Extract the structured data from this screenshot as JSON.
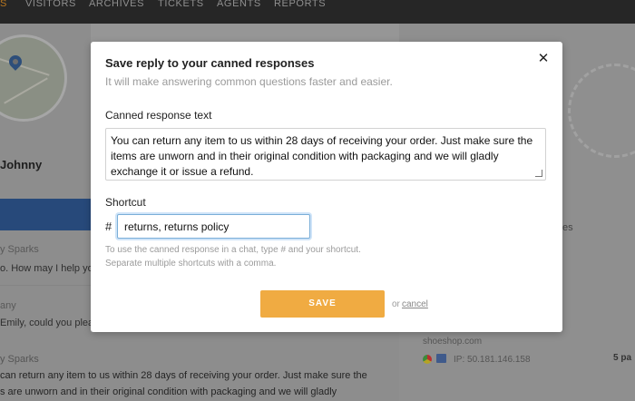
{
  "nav": {
    "items": [
      "S",
      "VISITORS",
      "ARCHIVES",
      "TICKETS",
      "AGENTS",
      "REPORTS"
    ]
  },
  "background": {
    "visitor_name": "Johnny",
    "messages": [
      {
        "author": "y Sparks",
        "text": "o. How may I help yo"
      },
      {
        "author": "any",
        "text": "Emily, could you plea"
      },
      {
        "author": "y Sparks",
        "text": "can return any item to us within 28 days of receiving your order. Just make sure the"
      }
    ],
    "last_message_line_2": "s are unworn and in their original condition with packaging and we will gladly",
    "right": {
      "label_fragment": "es",
      "domain": "shoeshop.com",
      "ip": "IP: 50.181.146.158",
      "count_fragment": "5 pa"
    }
  },
  "modal": {
    "title": "Save reply to your canned responses",
    "subtitle": "It will make answering common questions faster and easier.",
    "canned_label": "Canned response text",
    "canned_value": "You can return any item to us within 28 days of receiving your order. Just make sure the items are unworn and in their original condition with packaging and we will gladly exchange it or issue a refund.",
    "shortcut_label": "Shortcut",
    "hash": "#",
    "shortcut_value": "returns, returns policy",
    "hint_line_1": "To use the canned response in a chat, type # and your shortcut.",
    "hint_line_2": "Separate multiple shortcuts with a comma.",
    "save_label": "SAVE",
    "or_label": "or",
    "cancel_label": "cancel",
    "close_glyph": "✕"
  },
  "icons": [
    "close-icon",
    "map-pin-icon",
    "browser-icon",
    "os-icon"
  ],
  "colors": {
    "accent": "#f0ab42",
    "input_focus": "#7aaed8",
    "topbar": "#262626",
    "nav_active": "#b7761f"
  }
}
